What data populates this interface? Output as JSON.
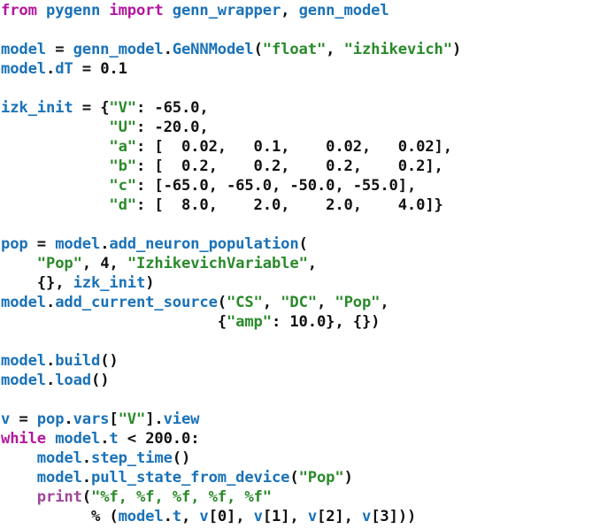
{
  "document": {
    "kind": "python-source-code-listing",
    "language": "Python",
    "background_color": "#ffffff",
    "colors": {
      "keyword": "#b5179e",
      "builtin": "#a0459a",
      "identifier": "#1a72b8",
      "string": "#2a8a2a",
      "number": "#111111",
      "operator": "#111111",
      "punctuation": "#111111"
    }
  },
  "code": {
    "lines": [
      {
        "id": "l1",
        "text": "from pygenn import genn_wrapper, genn_model",
        "tokens": [
          {
            "t": "from ",
            "c": "kw"
          },
          {
            "t": "pygenn",
            "c": "name"
          },
          {
            "t": " ",
            "c": "plain"
          },
          {
            "t": "import",
            "c": "kw"
          },
          {
            "t": " ",
            "c": "plain"
          },
          {
            "t": "genn_wrapper",
            "c": "name"
          },
          {
            "t": ", ",
            "c": "punc"
          },
          {
            "t": "genn_model",
            "c": "name"
          }
        ]
      },
      {
        "id": "l2",
        "text": "",
        "tokens": []
      },
      {
        "id": "l3",
        "text": "model = genn_model.GeNNModel(\"float\", \"izhikevich\")",
        "tokens": [
          {
            "t": "model",
            "c": "name"
          },
          {
            "t": " = ",
            "c": "op"
          },
          {
            "t": "genn_model",
            "c": "name"
          },
          {
            "t": ".",
            "c": "punc"
          },
          {
            "t": "GeNNModel",
            "c": "name"
          },
          {
            "t": "(",
            "c": "punc"
          },
          {
            "t": "\"float\"",
            "c": "str"
          },
          {
            "t": ", ",
            "c": "punc"
          },
          {
            "t": "\"izhikevich\"",
            "c": "str"
          },
          {
            "t": ")",
            "c": "punc"
          }
        ]
      },
      {
        "id": "l4",
        "text": "model.dT = 0.1",
        "tokens": [
          {
            "t": "model",
            "c": "name"
          },
          {
            "t": ".",
            "c": "punc"
          },
          {
            "t": "dT",
            "c": "name"
          },
          {
            "t": " = ",
            "c": "op"
          },
          {
            "t": "0.1",
            "c": "num"
          }
        ]
      },
      {
        "id": "l5",
        "text": "",
        "tokens": []
      },
      {
        "id": "l6",
        "text": "izk_init = {\"V\": -65.0,",
        "tokens": [
          {
            "t": "izk_init",
            "c": "name"
          },
          {
            "t": " = ",
            "c": "op"
          },
          {
            "t": "{",
            "c": "punc"
          },
          {
            "t": "\"V\"",
            "c": "str"
          },
          {
            "t": ": ",
            "c": "punc"
          },
          {
            "t": "-65.0",
            "c": "num"
          },
          {
            "t": ",",
            "c": "punc"
          }
        ]
      },
      {
        "id": "l7",
        "text": "            \"U\": -20.0,",
        "tokens": [
          {
            "t": "            ",
            "c": "plain"
          },
          {
            "t": "\"U\"",
            "c": "str"
          },
          {
            "t": ": ",
            "c": "punc"
          },
          {
            "t": "-20.0",
            "c": "num"
          },
          {
            "t": ",",
            "c": "punc"
          }
        ]
      },
      {
        "id": "l8",
        "text": "            \"a\": [  0.02,   0.1,    0.02,   0.02],",
        "tokens": [
          {
            "t": "            ",
            "c": "plain"
          },
          {
            "t": "\"a\"",
            "c": "str"
          },
          {
            "t": ": ",
            "c": "punc"
          },
          {
            "t": "[",
            "c": "punc"
          },
          {
            "t": "  0.02,   0.1,    0.02,   0.02",
            "c": "num"
          },
          {
            "t": "]",
            "c": "punc"
          },
          {
            "t": ",",
            "c": "punc"
          }
        ]
      },
      {
        "id": "l9",
        "text": "            \"b\": [  0.2,    0.2,    0.2,    0.2],",
        "tokens": [
          {
            "t": "            ",
            "c": "plain"
          },
          {
            "t": "\"b\"",
            "c": "str"
          },
          {
            "t": ": ",
            "c": "punc"
          },
          {
            "t": "[",
            "c": "punc"
          },
          {
            "t": "  0.2,    0.2,    0.2,    0.2",
            "c": "num"
          },
          {
            "t": "]",
            "c": "punc"
          },
          {
            "t": ",",
            "c": "punc"
          }
        ]
      },
      {
        "id": "l10",
        "text": "            \"c\": [-65.0, -65.0, -50.0, -55.0],",
        "tokens": [
          {
            "t": "            ",
            "c": "plain"
          },
          {
            "t": "\"c\"",
            "c": "str"
          },
          {
            "t": ": ",
            "c": "punc"
          },
          {
            "t": "[",
            "c": "punc"
          },
          {
            "t": "-65.0, -65.0, -50.0, -55.0",
            "c": "num"
          },
          {
            "t": "]",
            "c": "punc"
          },
          {
            "t": ",",
            "c": "punc"
          }
        ]
      },
      {
        "id": "l11",
        "text": "            \"d\": [  8.0,    2.0,    2.0,    4.0]}",
        "tokens": [
          {
            "t": "            ",
            "c": "plain"
          },
          {
            "t": "\"d\"",
            "c": "str"
          },
          {
            "t": ": ",
            "c": "punc"
          },
          {
            "t": "[",
            "c": "punc"
          },
          {
            "t": "  8.0,    2.0,    2.0,    4.0",
            "c": "num"
          },
          {
            "t": "]}",
            "c": "punc"
          }
        ]
      },
      {
        "id": "l12",
        "text": "",
        "tokens": []
      },
      {
        "id": "l13",
        "text": "pop = model.add_neuron_population(",
        "tokens": [
          {
            "t": "pop",
            "c": "name"
          },
          {
            "t": " = ",
            "c": "op"
          },
          {
            "t": "model",
            "c": "name"
          },
          {
            "t": ".",
            "c": "punc"
          },
          {
            "t": "add_neuron_population",
            "c": "name"
          },
          {
            "t": "(",
            "c": "punc"
          }
        ]
      },
      {
        "id": "l14",
        "text": "    \"Pop\", 4, \"IzhikevichVariable\",",
        "tokens": [
          {
            "t": "    ",
            "c": "plain"
          },
          {
            "t": "\"Pop\"",
            "c": "str"
          },
          {
            "t": ", ",
            "c": "punc"
          },
          {
            "t": "4",
            "c": "num"
          },
          {
            "t": ", ",
            "c": "punc"
          },
          {
            "t": "\"IzhikevichVariable\"",
            "c": "str"
          },
          {
            "t": ",",
            "c": "punc"
          }
        ]
      },
      {
        "id": "l15",
        "text": "    {}, izk_init)",
        "tokens": [
          {
            "t": "    ",
            "c": "plain"
          },
          {
            "t": "{}, ",
            "c": "punc"
          },
          {
            "t": "izk_init",
            "c": "name"
          },
          {
            "t": ")",
            "c": "punc"
          }
        ]
      },
      {
        "id": "l16",
        "text": "model.add_current_source(\"CS\", \"DC\", \"Pop\",",
        "tokens": [
          {
            "t": "model",
            "c": "name"
          },
          {
            "t": ".",
            "c": "punc"
          },
          {
            "t": "add_current_source",
            "c": "name"
          },
          {
            "t": "(",
            "c": "punc"
          },
          {
            "t": "\"CS\"",
            "c": "str"
          },
          {
            "t": ", ",
            "c": "punc"
          },
          {
            "t": "\"DC\"",
            "c": "str"
          },
          {
            "t": ", ",
            "c": "punc"
          },
          {
            "t": "\"Pop\"",
            "c": "str"
          },
          {
            "t": ",",
            "c": "punc"
          }
        ]
      },
      {
        "id": "l17",
        "text": "                        {\"amp\": 10.0}, {})",
        "tokens": [
          {
            "t": "                        ",
            "c": "plain"
          },
          {
            "t": "{",
            "c": "punc"
          },
          {
            "t": "\"amp\"",
            "c": "str"
          },
          {
            "t": ": ",
            "c": "punc"
          },
          {
            "t": "10.0",
            "c": "num"
          },
          {
            "t": "}, {})",
            "c": "punc"
          }
        ]
      },
      {
        "id": "l18",
        "text": "",
        "tokens": []
      },
      {
        "id": "l19",
        "text": "model.build()",
        "tokens": [
          {
            "t": "model",
            "c": "name"
          },
          {
            "t": ".",
            "c": "punc"
          },
          {
            "t": "build",
            "c": "name"
          },
          {
            "t": "()",
            "c": "punc"
          }
        ]
      },
      {
        "id": "l20",
        "text": "model.load()",
        "tokens": [
          {
            "t": "model",
            "c": "name"
          },
          {
            "t": ".",
            "c": "punc"
          },
          {
            "t": "load",
            "c": "name"
          },
          {
            "t": "()",
            "c": "punc"
          }
        ]
      },
      {
        "id": "l21",
        "text": "",
        "tokens": []
      },
      {
        "id": "l22",
        "text": "v = pop.vars[\"V\"].view",
        "tokens": [
          {
            "t": "v",
            "c": "name"
          },
          {
            "t": " = ",
            "c": "op"
          },
          {
            "t": "pop",
            "c": "name"
          },
          {
            "t": ".",
            "c": "punc"
          },
          {
            "t": "vars",
            "c": "name"
          },
          {
            "t": "[",
            "c": "punc"
          },
          {
            "t": "\"V\"",
            "c": "str"
          },
          {
            "t": "]",
            "c": "punc"
          },
          {
            "t": ".",
            "c": "punc"
          },
          {
            "t": "view",
            "c": "name"
          }
        ]
      },
      {
        "id": "l23",
        "text": "while model.t < 200.0:",
        "tokens": [
          {
            "t": "while ",
            "c": "kw"
          },
          {
            "t": "model",
            "c": "name"
          },
          {
            "t": ".",
            "c": "punc"
          },
          {
            "t": "t",
            "c": "name"
          },
          {
            "t": " < ",
            "c": "op"
          },
          {
            "t": "200.0",
            "c": "num"
          },
          {
            "t": ":",
            "c": "punc"
          }
        ]
      },
      {
        "id": "l24",
        "text": "    model.step_time()",
        "tokens": [
          {
            "t": "    ",
            "c": "plain"
          },
          {
            "t": "model",
            "c": "name"
          },
          {
            "t": ".",
            "c": "punc"
          },
          {
            "t": "step_time",
            "c": "name"
          },
          {
            "t": "()",
            "c": "punc"
          }
        ]
      },
      {
        "id": "l25",
        "text": "    model.pull_state_from_device(\"Pop\")",
        "tokens": [
          {
            "t": "    ",
            "c": "plain"
          },
          {
            "t": "model",
            "c": "name"
          },
          {
            "t": ".",
            "c": "punc"
          },
          {
            "t": "pull_state_from_device",
            "c": "name"
          },
          {
            "t": "(",
            "c": "punc"
          },
          {
            "t": "\"Pop\"",
            "c": "str"
          },
          {
            "t": ")",
            "c": "punc"
          }
        ]
      },
      {
        "id": "l26",
        "text": "    print(\"%f, %f, %f, %f, %f\"",
        "tokens": [
          {
            "t": "    ",
            "c": "plain"
          },
          {
            "t": "print",
            "c": "bi"
          },
          {
            "t": "(",
            "c": "punc"
          },
          {
            "t": "\"%f, %f, %f, %f, %f\"",
            "c": "str"
          }
        ]
      },
      {
        "id": "l27",
        "text": "          % (model.t, v[0], v[1], v[2], v[3]))",
        "tokens": [
          {
            "t": "          ",
            "c": "plain"
          },
          {
            "t": "% ",
            "c": "op"
          },
          {
            "t": "(",
            "c": "punc"
          },
          {
            "t": "model",
            "c": "name"
          },
          {
            "t": ".",
            "c": "punc"
          },
          {
            "t": "t",
            "c": "name"
          },
          {
            "t": ", ",
            "c": "punc"
          },
          {
            "t": "v",
            "c": "name"
          },
          {
            "t": "[",
            "c": "punc"
          },
          {
            "t": "0",
            "c": "num"
          },
          {
            "t": "], ",
            "c": "punc"
          },
          {
            "t": "v",
            "c": "name"
          },
          {
            "t": "[",
            "c": "punc"
          },
          {
            "t": "1",
            "c": "num"
          },
          {
            "t": "], ",
            "c": "punc"
          },
          {
            "t": "v",
            "c": "name"
          },
          {
            "t": "[",
            "c": "punc"
          },
          {
            "t": "2",
            "c": "num"
          },
          {
            "t": "], ",
            "c": "punc"
          },
          {
            "t": "v",
            "c": "name"
          },
          {
            "t": "[",
            "c": "punc"
          },
          {
            "t": "3",
            "c": "num"
          },
          {
            "t": "]))",
            "c": "punc"
          }
        ]
      }
    ]
  }
}
